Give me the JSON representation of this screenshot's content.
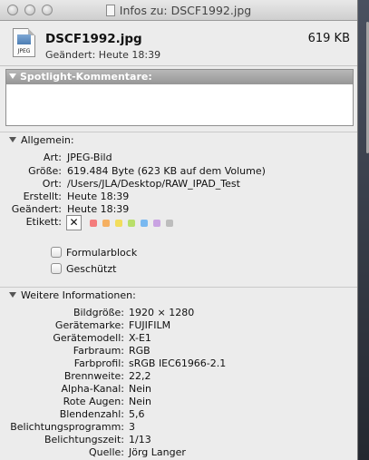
{
  "window": {
    "title": "Infos zu: DSCF1992.jpg"
  },
  "header": {
    "filename": "DSCF1992.jpg",
    "size": "619 KB",
    "modified": "Geändert:  Heute 18:39",
    "icon_label": "JPEG"
  },
  "spotlight": {
    "label": "Spotlight-Kommentare:"
  },
  "general": {
    "label": "Allgemein:",
    "rows": [
      {
        "label": "Art:",
        "value": "JPEG-Bild"
      },
      {
        "label": "Größe:",
        "value": "619.484 Byte (623 KB auf dem Volume)"
      },
      {
        "label": "Ort:",
        "value": "/Users/JLA/Desktop/RAW_IPAD_Test"
      },
      {
        "label": "Erstellt:",
        "value": "Heute 18:39"
      },
      {
        "label": "Geändert:",
        "value": "Heute 18:39"
      }
    ],
    "tag_label": "Etikett:",
    "tag_none_symbol": "✕",
    "tag_colors": [
      "#f47c7c",
      "#f5b062",
      "#f2dd5c",
      "#b9df6a",
      "#79b8f0",
      "#c9a3e2",
      "#bdbdbd"
    ],
    "checkboxes": [
      {
        "label": "Formularblock",
        "checked": false
      },
      {
        "label": "Geschützt",
        "checked": false
      }
    ]
  },
  "more": {
    "label": "Weitere Informationen:",
    "rows": [
      {
        "label": "Bildgröße:",
        "value": "1920 × 1280"
      },
      {
        "label": "Gerätemarke:",
        "value": "FUJIFILM"
      },
      {
        "label": "Gerätemodell:",
        "value": "X-E1"
      },
      {
        "label": "Farbraum:",
        "value": "RGB"
      },
      {
        "label": "Farbprofil:",
        "value": "sRGB IEC61966-2.1"
      },
      {
        "label": "Brennweite:",
        "value": "22,2"
      },
      {
        "label": "Alpha-Kanal:",
        "value": "Nein"
      },
      {
        "label": "Rote Augen:",
        "value": "Nein"
      },
      {
        "label": "Blendenzahl:",
        "value": "5,6"
      },
      {
        "label": "Belichtungsprogramm:",
        "value": "3"
      },
      {
        "label": "Belichtungszeit:",
        "value": "1/13"
      },
      {
        "label": "Quelle:",
        "value": "Jörg Langer"
      }
    ]
  }
}
